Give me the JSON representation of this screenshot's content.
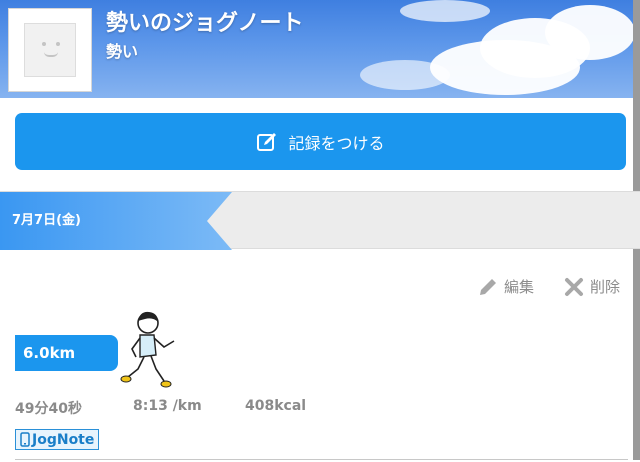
{
  "header": {
    "title": "勢いのジョグノート",
    "subtitle": "勢い"
  },
  "record_button": {
    "label": "記録をつける"
  },
  "entry": {
    "date": "7月7日(金)",
    "edit_label": "編集",
    "delete_label": "削除",
    "distance": "6.0km",
    "time": "49分40秒",
    "pace": "8:13 /km",
    "calories": "408kcal"
  },
  "badge": {
    "label": "JogNote"
  },
  "colors": {
    "accent": "#1b96ee",
    "sky_top": "#3f7fe0",
    "date_band": "#ececec",
    "muted_text": "#8a8a8a"
  },
  "icons": {
    "record": "pencil-square-icon",
    "edit": "pencil-icon",
    "delete": "cross-icon",
    "runner": "runner-illustration",
    "badge": "phone-icon"
  }
}
